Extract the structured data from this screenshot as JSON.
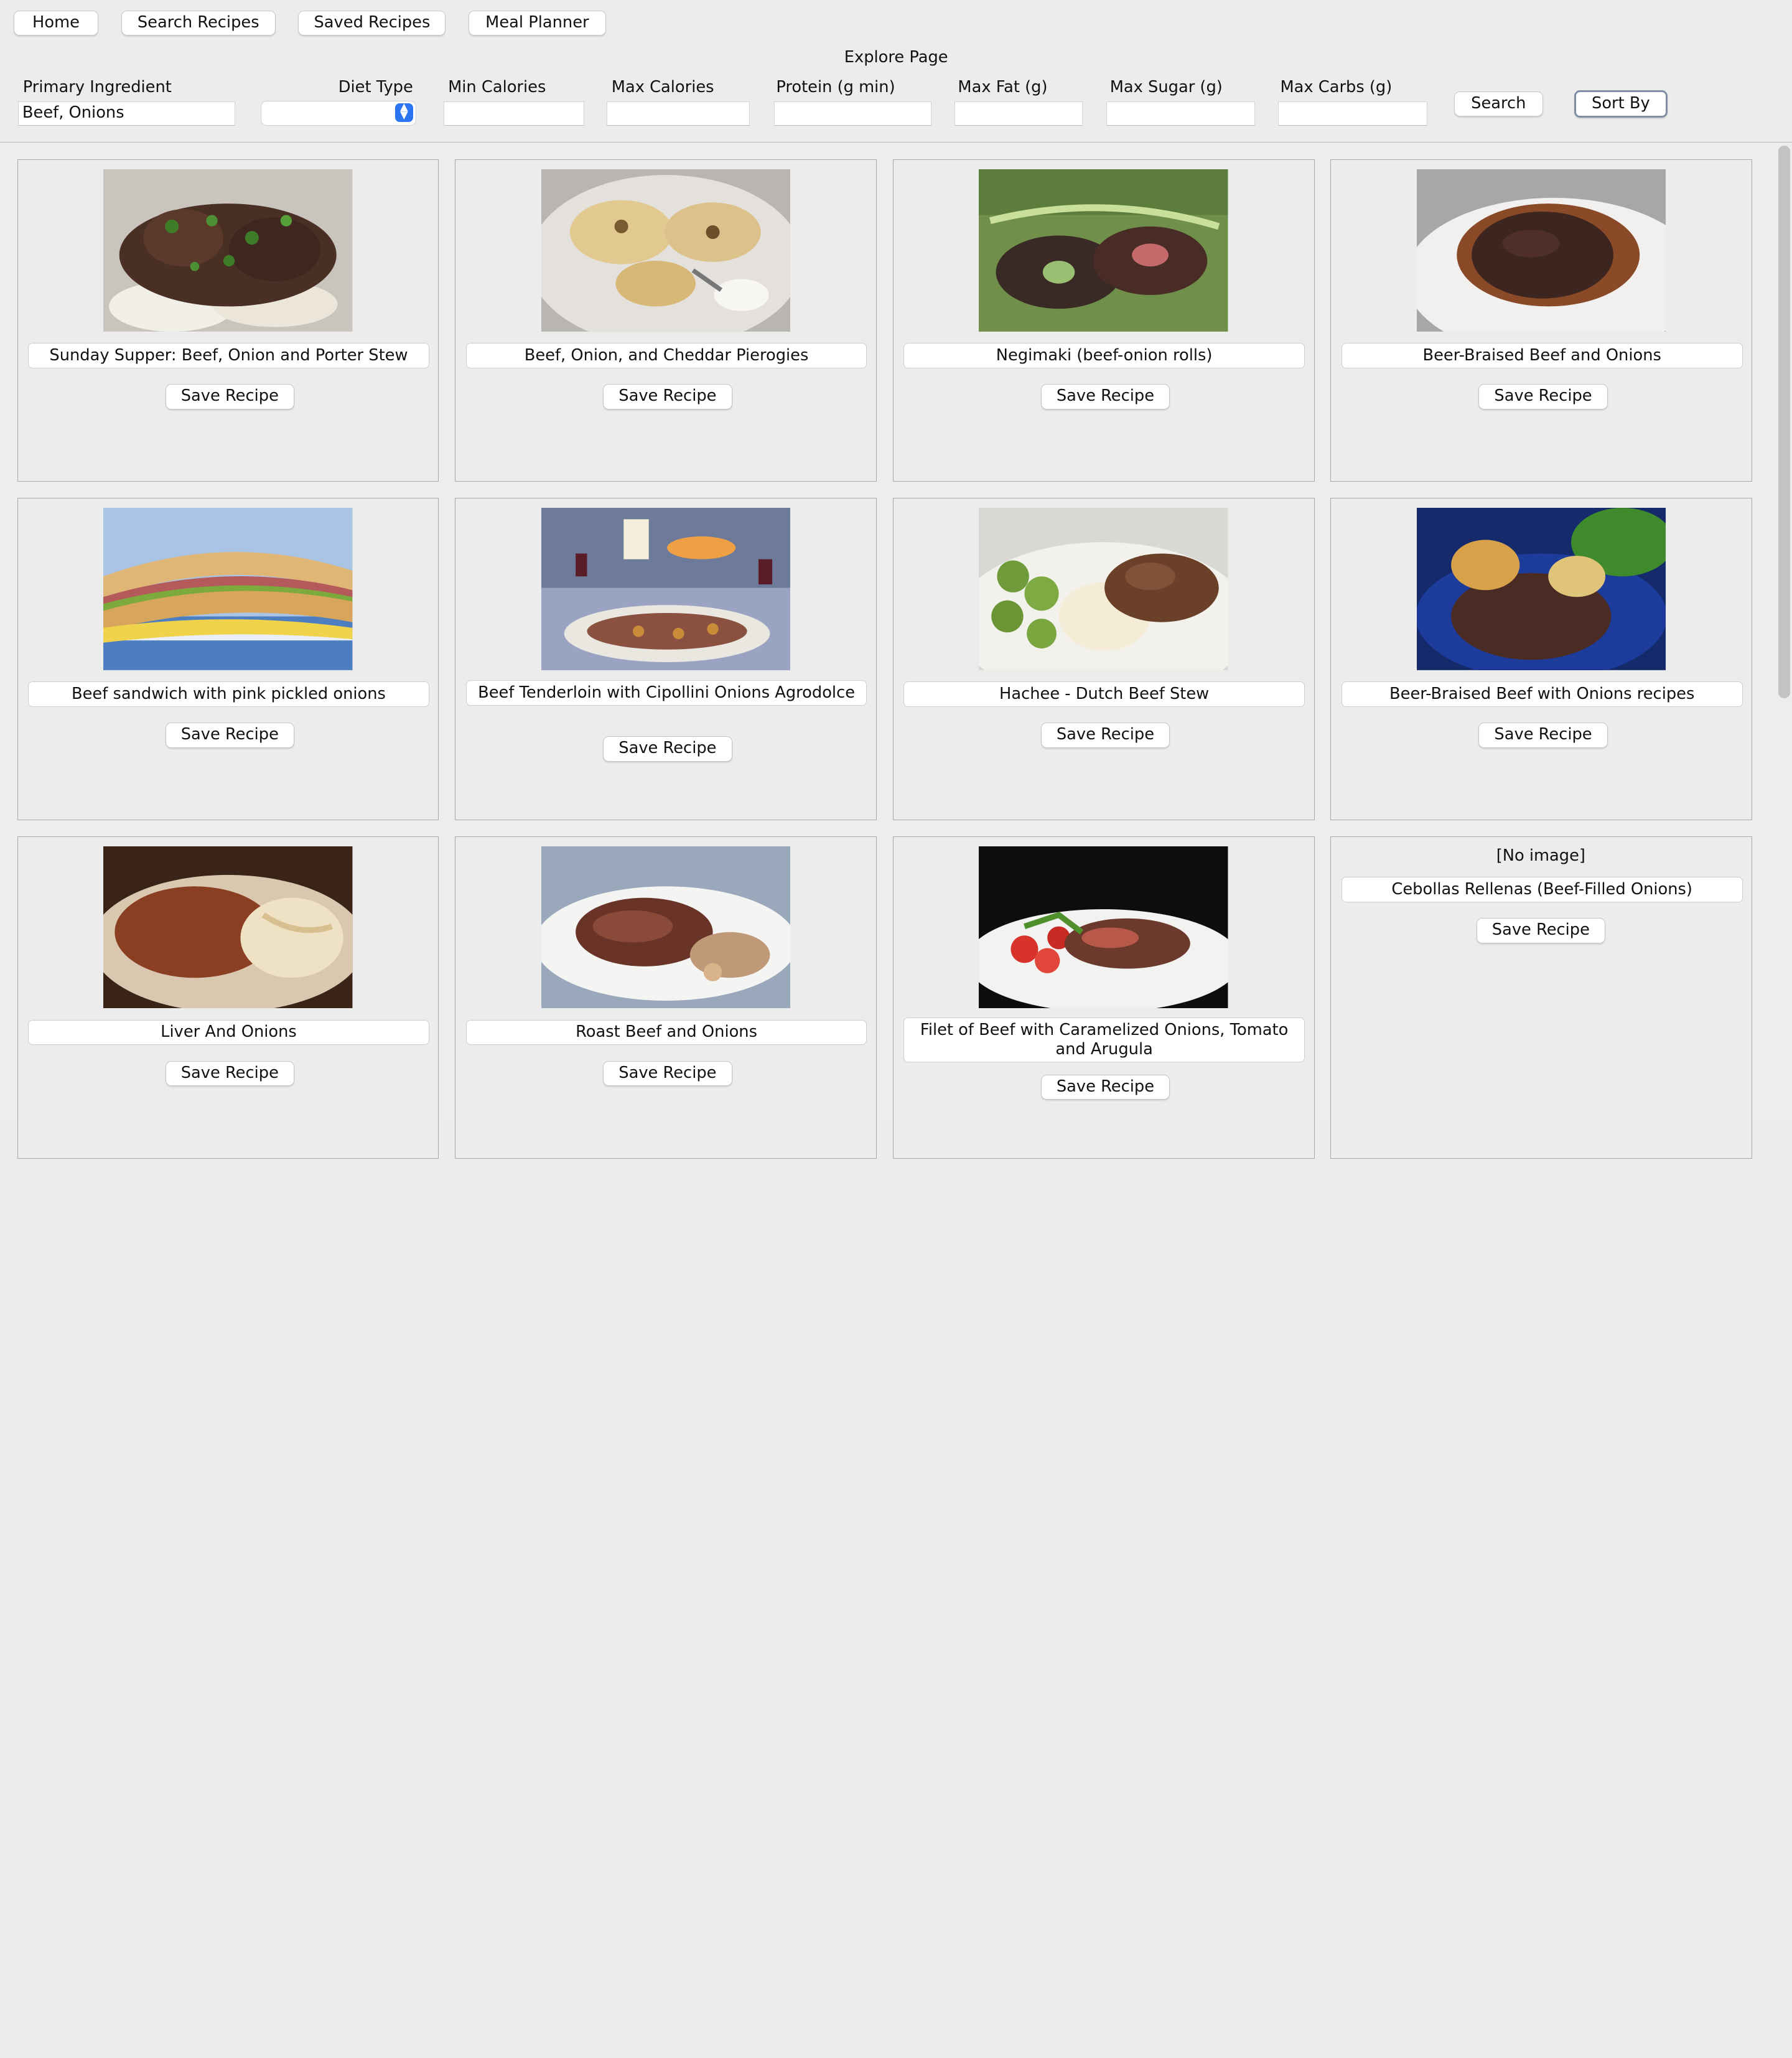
{
  "nav": {
    "home": "Home",
    "search_recipes": "Search Recipes",
    "saved_recipes": "Saved Recipes",
    "meal_planner": "Meal Planner"
  },
  "page_title": "Explore Page",
  "filters": {
    "primary_ingredient": {
      "label": "Primary Ingredient",
      "value": "Beef, Onions"
    },
    "diet_type": {
      "label": "Diet Type",
      "value": ""
    },
    "min_calories": {
      "label": "Min Calories",
      "value": ""
    },
    "max_calories": {
      "label": "Max Calories",
      "value": ""
    },
    "protein": {
      "label": "Protein (g min)",
      "value": ""
    },
    "max_fat": {
      "label": "Max Fat (g)",
      "value": ""
    },
    "max_sugar": {
      "label": "Max Sugar (g)",
      "value": ""
    },
    "max_carbs": {
      "label": "Max Carbs (g)",
      "value": ""
    },
    "search_label": "Search",
    "sort_label": "Sort By"
  },
  "save_label": "Save Recipe",
  "no_image_label": "[No image]",
  "recipes": [
    {
      "title": "Sunday Supper: Beef, Onion and Porter Stew"
    },
    {
      "title": "Beef, Onion, and Cheddar Pierogies"
    },
    {
      "title": "Negimaki (beef-onion rolls)"
    },
    {
      "title": "Beer-Braised Beef and Onions"
    },
    {
      "title": "Beef sandwich with pink pickled onions"
    },
    {
      "title": "Beef Tenderloin with Cipollini Onions Agrodolce"
    },
    {
      "title": "Hachee - Dutch Beef Stew"
    },
    {
      "title": "Beer-Braised Beef with Onions recipes"
    },
    {
      "title": "Liver And Onions"
    },
    {
      "title": "Roast Beef and Onions"
    },
    {
      "title": "Filet of Beef with Caramelized Onions, Tomato and Arugula"
    },
    {
      "title": "Cebollas Rellenas (Beef-Filled Onions)"
    }
  ]
}
